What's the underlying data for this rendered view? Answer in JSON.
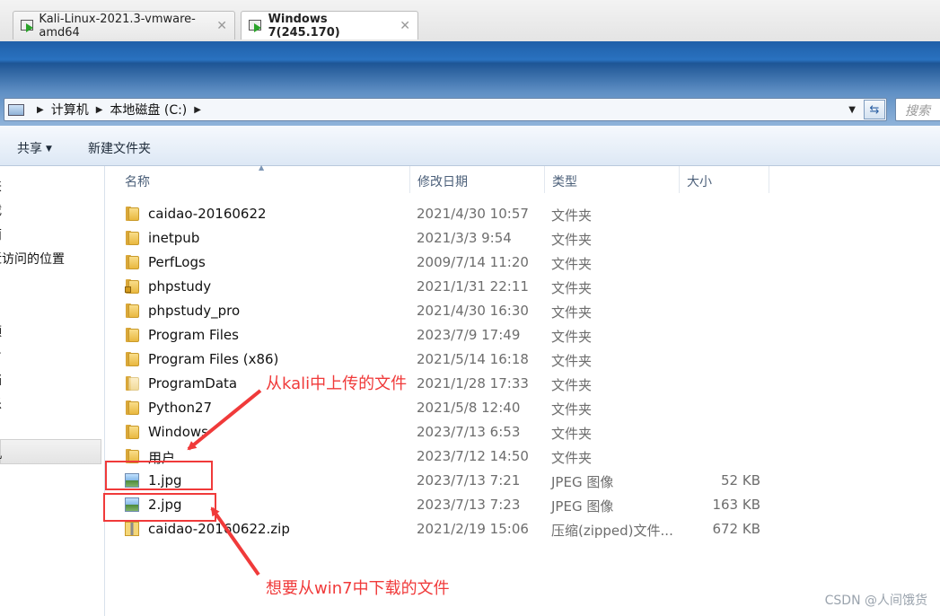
{
  "tabs": [
    {
      "label": "Kali-Linux-2021.3-vmware-amd64",
      "active": false
    },
    {
      "label": "Windows 7(245.170)",
      "active": true
    }
  ],
  "address_bar": {
    "crumbs": [
      "计算机",
      "本地磁盘 (C:)"
    ],
    "search_placeholder": "搜索 "
  },
  "command_bar": {
    "share_label": "共享",
    "new_folder_label": "新建文件夹"
  },
  "nav_pane": {
    "items": [
      "夹",
      "载",
      "面",
      "近访问的位置",
      "频",
      "片",
      "档",
      "乐",
      "机"
    ],
    "selected_index": 8
  },
  "columns": {
    "name": "名称",
    "date": "修改日期",
    "type": "类型",
    "size": "大小"
  },
  "files": [
    {
      "name": "caidao-20160622",
      "date": "2021/4/30 10:57",
      "type": "文件夹",
      "size": "",
      "icon": "folder-icon"
    },
    {
      "name": "inetpub",
      "date": "2021/3/3 9:54",
      "type": "文件夹",
      "size": "",
      "icon": "folder-icon"
    },
    {
      "name": "PerfLogs",
      "date": "2009/7/14 11:20",
      "type": "文件夹",
      "size": "",
      "icon": "folder-icon"
    },
    {
      "name": "phpstudy",
      "date": "2021/1/31 22:11",
      "type": "文件夹",
      "size": "",
      "icon": "locked-folder-icon"
    },
    {
      "name": "phpstudy_pro",
      "date": "2021/4/30 16:30",
      "type": "文件夹",
      "size": "",
      "icon": "folder-icon"
    },
    {
      "name": "Program Files",
      "date": "2023/7/9 17:49",
      "type": "文件夹",
      "size": "",
      "icon": "folder-icon"
    },
    {
      "name": "Program Files (x86)",
      "date": "2021/5/14 16:18",
      "type": "文件夹",
      "size": "",
      "icon": "folder-icon"
    },
    {
      "name": "ProgramData",
      "date": "2021/1/28 17:33",
      "type": "文件夹",
      "size": "",
      "icon": "hidden-folder-icon"
    },
    {
      "name": "Python27",
      "date": "2021/5/8 12:40",
      "type": "文件夹",
      "size": "",
      "icon": "folder-icon"
    },
    {
      "name": "Windows",
      "date": "2023/7/13 6:53",
      "type": "文件夹",
      "size": "",
      "icon": "folder-icon"
    },
    {
      "name": "用户",
      "date": "2023/7/12 14:50",
      "type": "文件夹",
      "size": "",
      "icon": "folder-icon"
    },
    {
      "name": "1.jpg",
      "date": "2023/7/13 7:21",
      "type": "JPEG 图像",
      "size": "52 KB",
      "icon": "image-file-icon"
    },
    {
      "name": "2.jpg",
      "date": "2023/7/13 7:23",
      "type": "JPEG 图像",
      "size": "163 KB",
      "icon": "image-file-icon"
    },
    {
      "name": "caidao-20160622.zip",
      "date": "2021/2/19 15:06",
      "type": "压缩(zipped)文件...",
      "size": "672 KB",
      "icon": "zip-file-icon"
    }
  ],
  "annotations": {
    "uploaded_label": "从kali中上传的文件",
    "download_label": "想要从win7中下载的文件",
    "color": "#f03a3a"
  },
  "watermark": "CSDN @人间饿货"
}
